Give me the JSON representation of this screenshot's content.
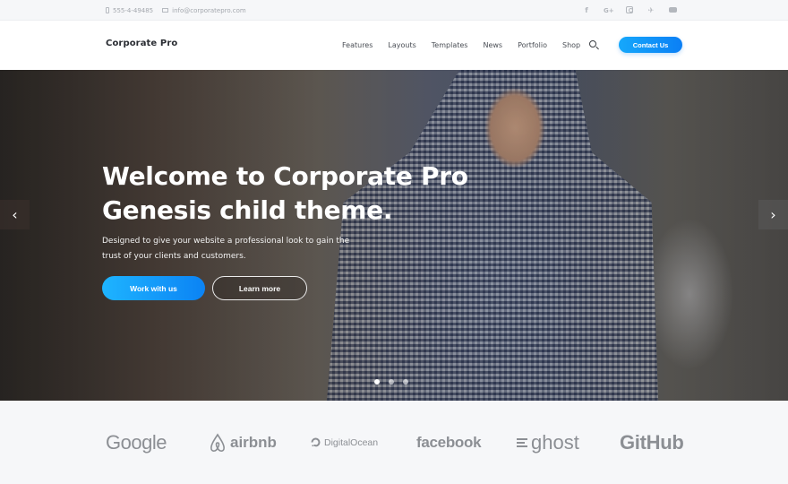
{
  "topbar": {
    "phone": "555-4-49485",
    "email": "info@corporatepro.com",
    "phone_icon": "phone-icon",
    "email_icon": "mail-icon",
    "social": [
      {
        "name": "facebook",
        "glyph": "f"
      },
      {
        "name": "google-plus",
        "glyph": "G+"
      },
      {
        "name": "instagram",
        "glyph": ""
      },
      {
        "name": "twitter",
        "glyph": "🐦"
      },
      {
        "name": "youtube",
        "glyph": ""
      }
    ]
  },
  "header": {
    "logo": "Corporate Pro",
    "nav": [
      "Features",
      "Layouts",
      "Templates",
      "News",
      "Portfolio",
      "Shop"
    ],
    "search_icon": "search-icon",
    "contact_button": "Contact Us",
    "accent_color": "#0b83f4"
  },
  "hero": {
    "title_line1": "Welcome to Corporate Pro",
    "title_line2": "Genesis child theme.",
    "description": "Designed to give your website a professional look to gain the trust of your clients and customers.",
    "primary_button": "Work with us",
    "secondary_button": "Learn more",
    "prev_arrow": "‹",
    "next_arrow": "›",
    "slides": 3,
    "active_slide": 1
  },
  "logos": {
    "items": [
      "Google",
      "airbnb",
      "DigitalOcean",
      "facebook",
      "ghost",
      "GitHub"
    ]
  }
}
